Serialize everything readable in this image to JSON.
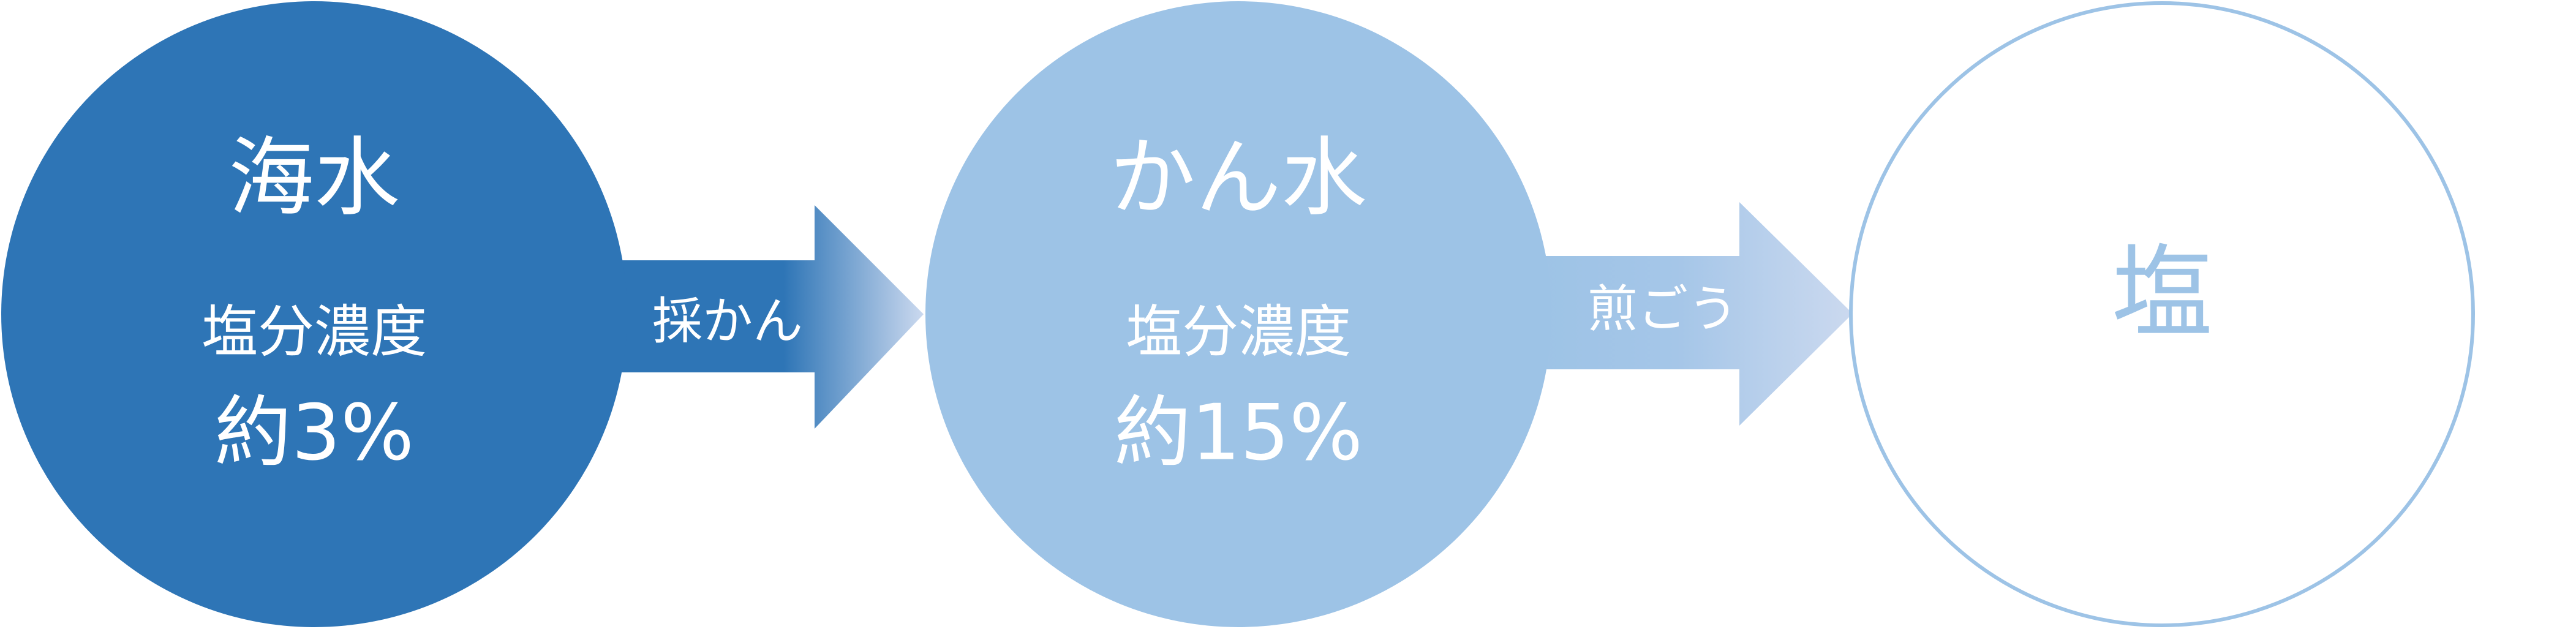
{
  "stages": [
    {
      "title": "海水",
      "label": "塩分濃度",
      "value": "約3%"
    },
    {
      "title": "かん水",
      "label": "塩分濃度",
      "value": "約15%"
    },
    {
      "title": "塩"
    }
  ],
  "arrows": [
    {
      "label": "採かん"
    },
    {
      "label": "煎ごう"
    }
  ],
  "colors": {
    "stage1_fill": "#2e75b6",
    "stage2_fill": "#9dc3e6",
    "stage3_stroke": "#9dc3e6",
    "text_white": "#ffffff",
    "text_light_blue": "#9dc3e6",
    "arrow1_start": "#2e75b6",
    "arrow1_end": "#cbd9ef",
    "arrow2_start": "#9dc3e6",
    "arrow2_end": "#cbd9ef"
  }
}
